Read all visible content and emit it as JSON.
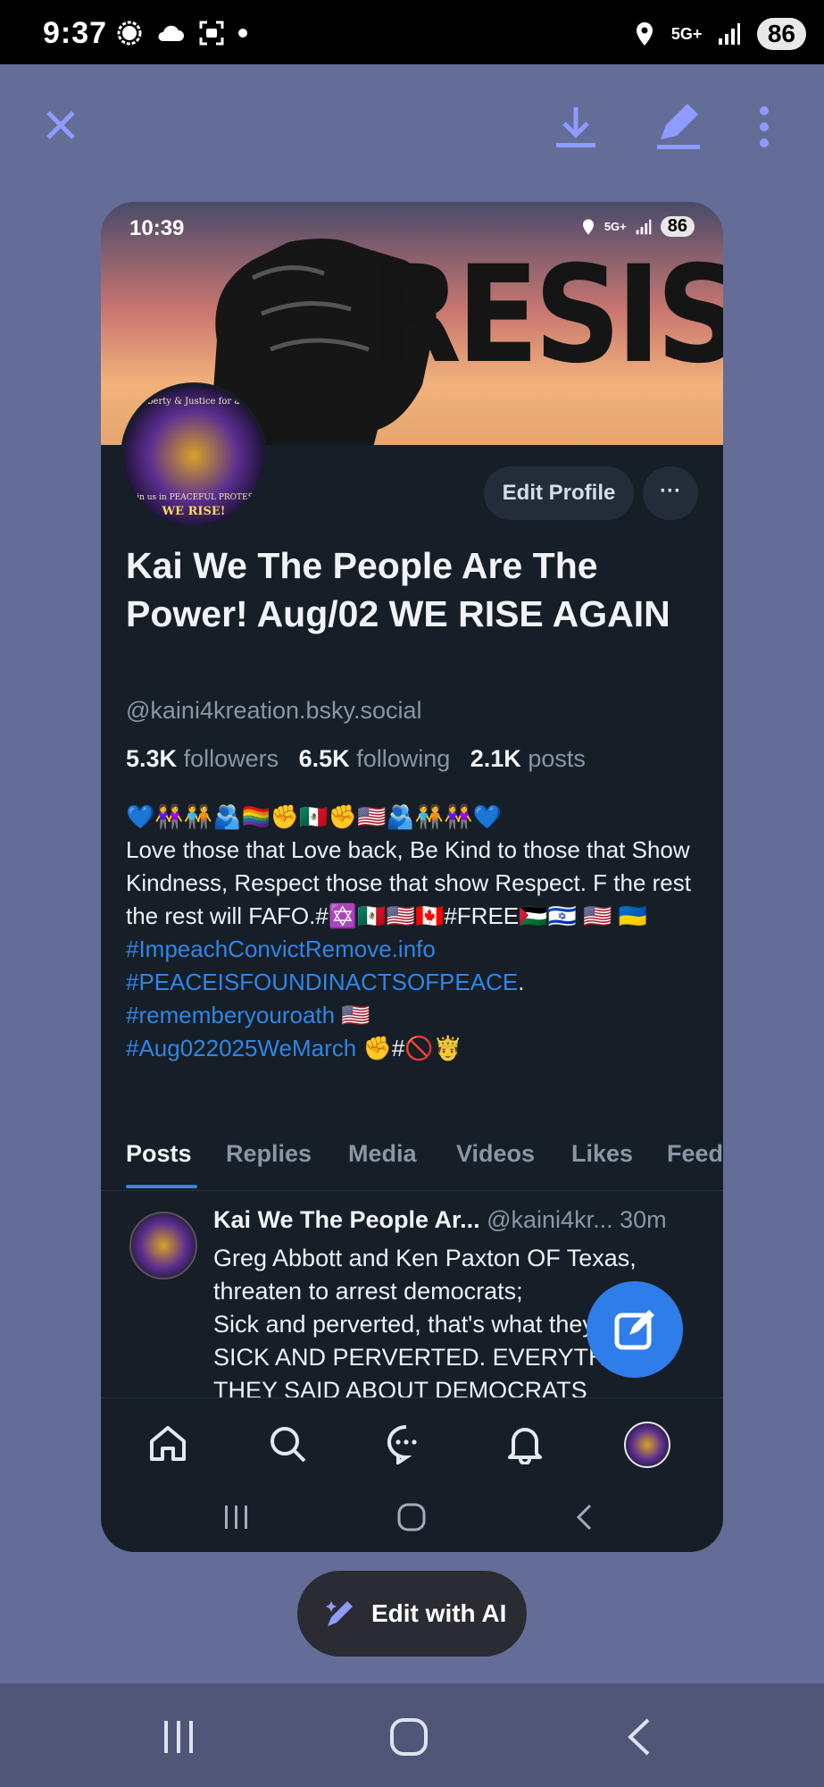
{
  "status_bar": {
    "time": "9:37",
    "network": "5G+",
    "battery": "86",
    "icons": [
      "signal-messenger-icon",
      "cloud-icon",
      "screenshot-icon",
      "dot-icon",
      "location-icon",
      "network-5g-icon",
      "signal-bars-icon",
      "battery-icon"
    ]
  },
  "viewer_toolbar": {
    "icons": [
      "close-icon",
      "download-icon",
      "edit-pen-icon",
      "more-vert-icon"
    ]
  },
  "screenshot": {
    "status_bar": {
      "time": "10:39",
      "network": "5G+",
      "battery": "86"
    },
    "banner": {
      "text": "RESIST"
    },
    "avatar": {
      "top_text": "Liberty & Justice for all!",
      "bottom_text": "Join us in PEACEFUL PROTEST",
      "logo_text": "WE RISE!"
    },
    "edit_profile_label": "Edit Profile",
    "more_label": "···",
    "display_name": "Kai We The People Are The Power! Aug/02 WE RISE AGAIN",
    "handle": "@kaini4kreation.bsky.social",
    "stats": {
      "followers_count": "5.3K",
      "followers_label": "followers",
      "following_count": "6.5K",
      "following_label": "following",
      "posts_count": "2.1K",
      "posts_label": "posts"
    },
    "bio": {
      "emoji_line": "💙👭🧑‍🤝‍🧑🫂🏳️‍🌈✊🇲🇽✊🇺🇸🫂🧑‍🤝‍🧑👭💙",
      "text_1": "Love those that Love back, Be Kind to those that Show Kindness, Respect those that show Respect. F the rest the rest will FAFO.#✡️🇲🇽🇺🇸🇨🇦#FREE🇵🇸🇮🇱 🇺🇸 🇺🇦",
      "link_1": "#ImpeachConvictRemove.info",
      "link_2": "#PEACEISFOUNDINACTSOFPEACE",
      "link_2_suffix": ".",
      "link_3": "#rememberyouroath",
      "link_3_suffix": " 🇺🇸",
      "link_4": "#Aug022025WeMarch",
      "link_4_suffix": " ✊#🚫🤴"
    },
    "tabs": [
      "Posts",
      "Replies",
      "Media",
      "Videos",
      "Likes",
      "Feed"
    ],
    "active_tab": "Posts",
    "post": {
      "author": "Kai We The People Ar...",
      "handle": "@kaini4kr...",
      "time": "30m",
      "text_lines": [
        "Greg Abbott and Ken Paxton OF Texas,",
        "threaten to arrest democrats;",
        "Sick and perverted, that's what they are,",
        "SICK AND PERVERTED. EVERYTHING",
        "THEY SAID ABOUT DEMOCRATS"
      ]
    },
    "bottom_nav": [
      "home-icon",
      "search-icon",
      "chat-icon",
      "bell-icon",
      "profile-avatar"
    ],
    "system_nav": [
      "recents-icon",
      "home-circle-icon",
      "back-icon"
    ]
  },
  "edit_with_ai_label": "Edit with AI",
  "system_nav": [
    "recents-icon",
    "home-icon",
    "back-icon"
  ],
  "colors": {
    "background": "#646d97",
    "accent": "#8e9bff",
    "card": "#161e27",
    "link": "#2f86e5",
    "fab": "#2f7de8"
  }
}
